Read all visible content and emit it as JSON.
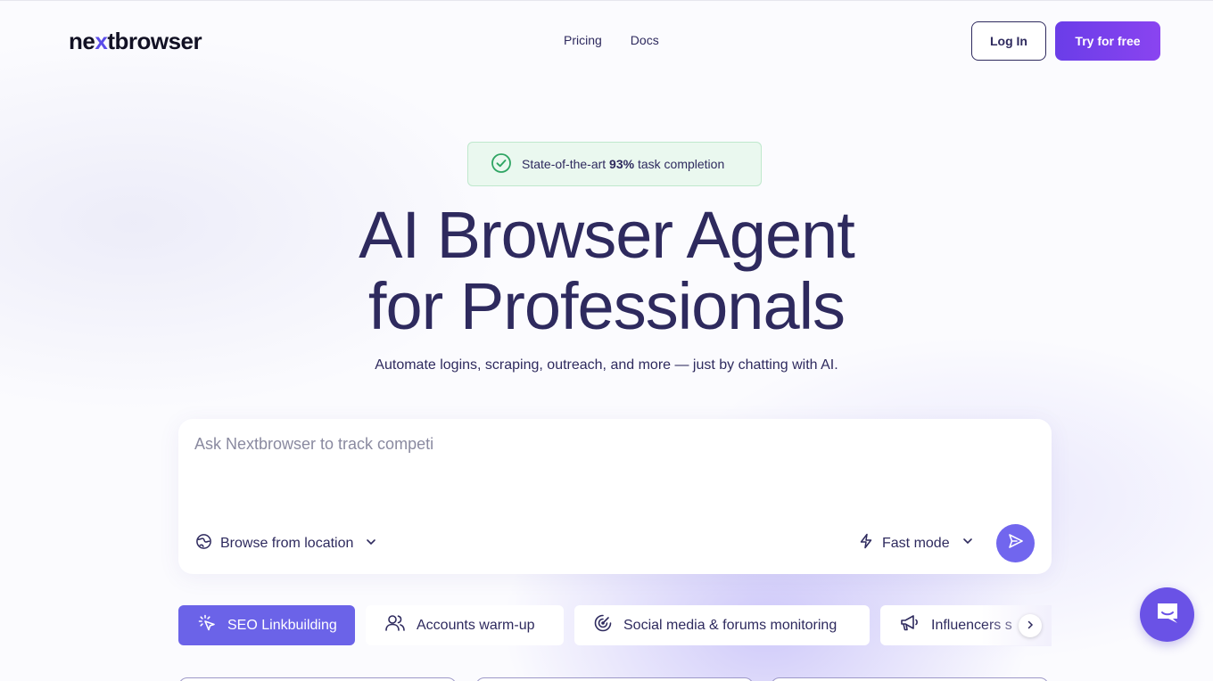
{
  "header": {
    "logo_pre": "ne",
    "logo_x": "x",
    "logo_post": "tbrowser",
    "nav": [
      "Pricing",
      "Docs"
    ],
    "login_label": "Log In",
    "try_label": "Try for free"
  },
  "badge": {
    "pre": "State-of-the-art ",
    "highlight": "93%",
    "post": " task completion"
  },
  "hero": {
    "title_line1": "AI Browser Agent",
    "title_line2": "for Professionals",
    "subtitle": "Automate logins, scraping, outreach, and more — just by chatting with AI."
  },
  "prompt": {
    "placeholder": "Ask Nextbrowser to track competi",
    "location_label": "Browse from location",
    "mode_label": "Fast mode"
  },
  "chips": [
    {
      "label": "SEO Linkbuilding",
      "icon": "cursor-click-icon",
      "active": true
    },
    {
      "label": "Accounts warm-up",
      "icon": "users-icon",
      "active": false
    },
    {
      "label": "Social media & forums monitoring",
      "icon": "radar-icon",
      "active": false
    },
    {
      "label": "Influencers s",
      "icon": "megaphone-icon",
      "active": false
    }
  ],
  "colors": {
    "accent": "#6b63e8",
    "brand_text": "#2e2a5e",
    "badge_bg": "#eaf8ef",
    "badge_border": "#bfe8cd",
    "check": "#2fa563"
  }
}
